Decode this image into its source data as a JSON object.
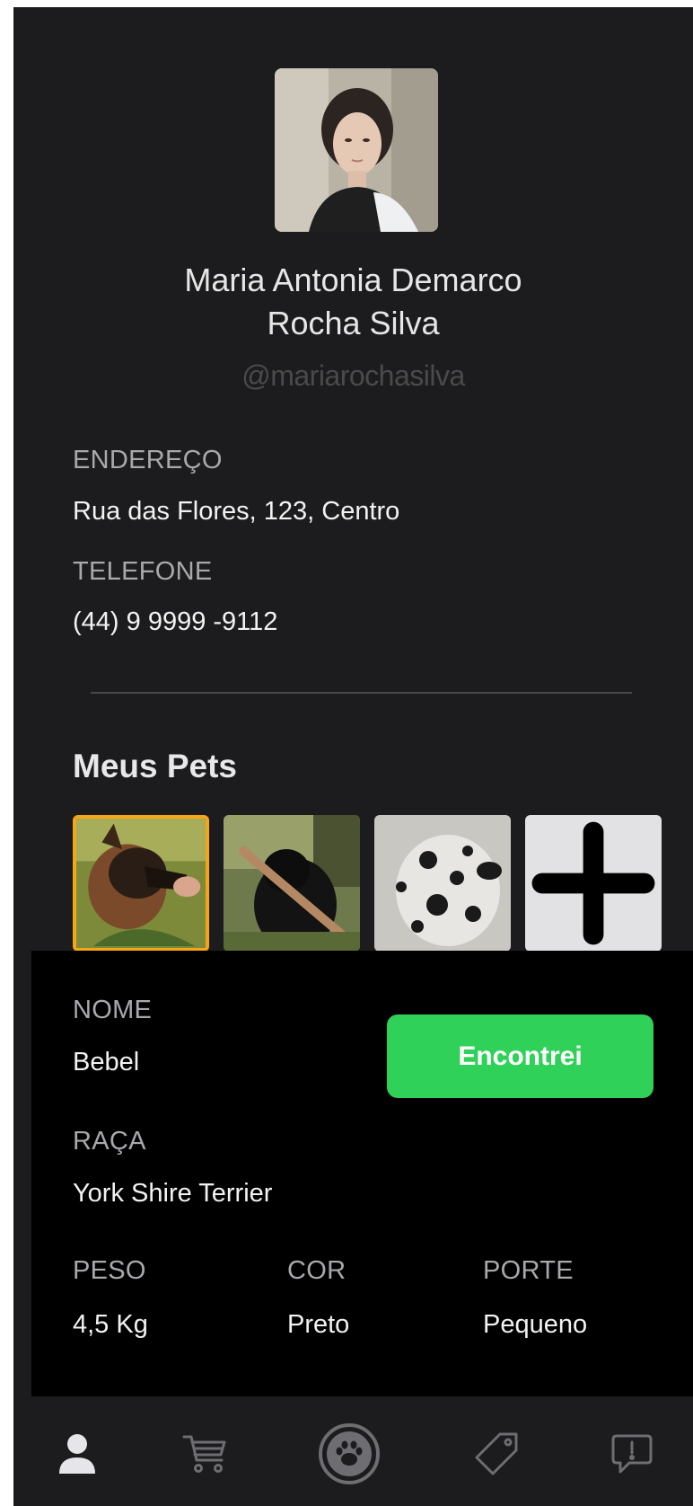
{
  "profile": {
    "name_line1": "Maria Antonia Demarco",
    "name_line2": "Rocha Silva",
    "handle": "@mariarochasilva",
    "address_label": "ENDEREÇO",
    "address": "Rua das Flores, 123, Centro",
    "phone_label": "TELEFONE",
    "phone": "(44) 9 9999 -9112"
  },
  "pets_section": {
    "title": "Meus Pets",
    "pets": [
      {
        "photo": "german-shepherd-photo",
        "selected": true
      },
      {
        "photo": "black-dog-with-stick-photo",
        "selected": false
      },
      {
        "photo": "spotted-dog-photo",
        "selected": false
      }
    ],
    "add_icon": "plus-icon"
  },
  "pet_detail": {
    "name_label": "NOME",
    "name": "Bebel",
    "breed_label": "RAÇA",
    "breed": "York Shire Terrier",
    "weight_label": "PESO",
    "weight": "4,5 Kg",
    "color_label": "COR",
    "color": "Preto",
    "size_label": "PORTE",
    "size": "Pequeno",
    "found_button": "Encontrei"
  },
  "tabbar": {
    "tabs": [
      {
        "icon": "user-icon",
        "active": true
      },
      {
        "icon": "cart-icon",
        "active": false
      },
      {
        "icon": "paw-icon",
        "active": false
      },
      {
        "icon": "tag-icon",
        "active": false
      },
      {
        "icon": "alert-message-icon",
        "active": false
      }
    ]
  },
  "colors": {
    "background": "#1c1c1e",
    "panel": "#000000",
    "accent_green": "#30d158",
    "selected_border": "#f5a51a",
    "label": "#a9a9ad",
    "value": "#f2f2f2"
  }
}
